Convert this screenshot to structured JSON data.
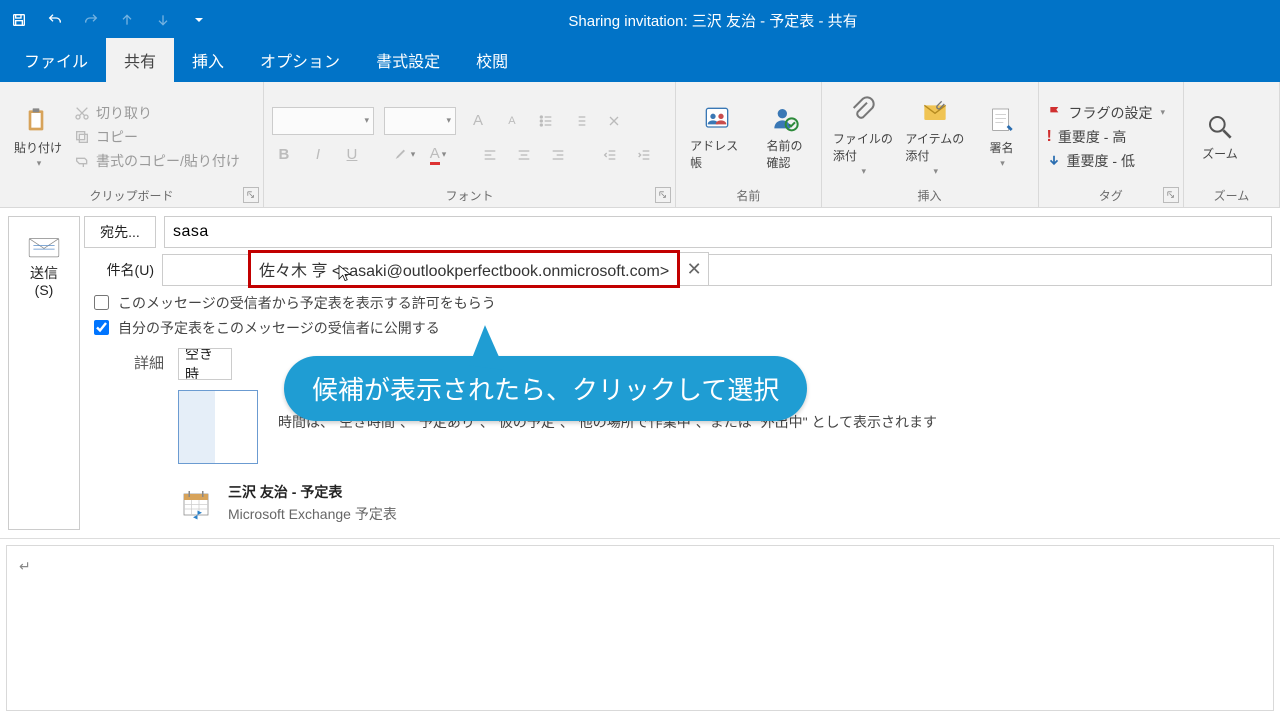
{
  "title": "Sharing invitation: 三沢 友治 - 予定表 - 共有",
  "menu": {
    "file": "ファイル",
    "share": "共有",
    "insert": "挿入",
    "option": "オプション",
    "format": "書式設定",
    "review": "校閲"
  },
  "ribbon": {
    "clipboard": {
      "paste": "貼り付け",
      "cut": "切り取り",
      "copy": "コピー",
      "brush": "書式のコピー/貼り付け",
      "label": "クリップボード"
    },
    "font": {
      "label": "フォント"
    },
    "names": {
      "addressbook": "アドレス帳",
      "checknames": "名前の\n確認",
      "label": "名前"
    },
    "attach": {
      "file": "ファイルの\n添付",
      "item": "アイテムの\n添付",
      "sign": "署名",
      "label": "挿入"
    },
    "tags": {
      "flag": "フラグの設定",
      "high": "重要度 - 高",
      "low": "重要度 - 低",
      "label": "タグ"
    },
    "zoom": {
      "zoom": "ズーム",
      "label": "ズーム"
    }
  },
  "fields": {
    "send": "送信\n(S)",
    "to_label": "宛先...",
    "to_value": "sasa",
    "subject_label": "件名(U)",
    "check1": "このメッセージの受信者から予定表を表示する許可をもらう",
    "check2": "自分の予定表をこのメッセージの受信者に公開する",
    "detail_label": "詳細",
    "detail_select": "空き時",
    "time_info": "時間は、\"空き時間\"、\"予定あり\"、\"仮の予定\"、\"他の場所で作業中\"、または \"外出中\" として表示されます",
    "cal_title": "三沢 友治 - 予定表",
    "cal_provider": "Microsoft Exchange 予定表"
  },
  "autocomplete": {
    "entry": "佐々木 亨  <sasaki@outlookperfectbook.onmicrosoft.com>"
  },
  "callout": "候補が表示されたら、クリックして選択",
  "editor_mark": "↵"
}
